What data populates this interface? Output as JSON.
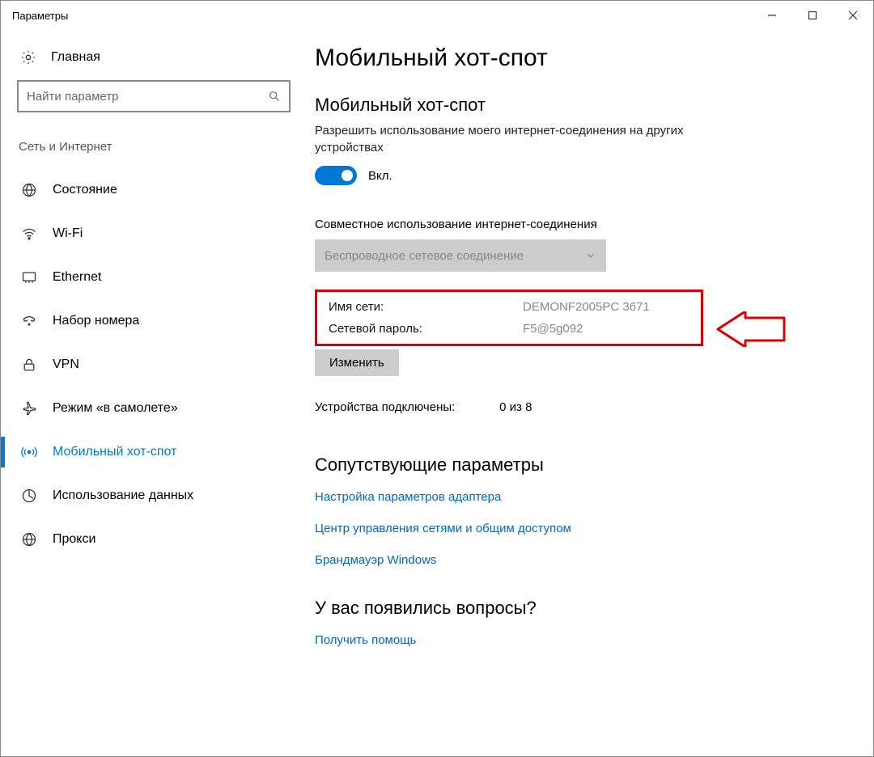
{
  "window": {
    "title": "Параметры"
  },
  "sidebar": {
    "home": "Главная",
    "search_placeholder": "Найти параметр",
    "group": "Сеть и Интернет",
    "items": [
      {
        "icon": "status-icon",
        "label": "Состояние"
      },
      {
        "icon": "wifi-icon",
        "label": "Wi-Fi"
      },
      {
        "icon": "ethernet-icon",
        "label": "Ethernet"
      },
      {
        "icon": "dialup-icon",
        "label": "Набор номера"
      },
      {
        "icon": "vpn-icon",
        "label": "VPN"
      },
      {
        "icon": "airplane-icon",
        "label": "Режим «в самолете»"
      },
      {
        "icon": "hotspot-icon",
        "label": "Мобильный хот-спот",
        "active": true
      },
      {
        "icon": "data-usage-icon",
        "label": "Использование данных"
      },
      {
        "icon": "proxy-icon",
        "label": "Прокси"
      }
    ]
  },
  "main": {
    "title": "Мобильный хот-спот",
    "section_title": "Мобильный хот-спот",
    "description": "Разрешить использование моего интернет-соединения на других устройствах",
    "toggle_label": "Вкл.",
    "share_label": "Совместное использование интернет-соединения",
    "dropdown_value": "Беспроводное сетевое соединение",
    "net_name_label": "Имя сети:",
    "net_name_value": "DEMONF2005PC 3671",
    "net_pass_label": "Сетевой пароль:",
    "net_pass_value": "F5@5g092",
    "change_btn": "Изменить",
    "devices_label": "Устройства подключены:",
    "devices_value": "0 из 8",
    "related_title": "Сопутствующие параметры",
    "related_links": [
      "Настройка параметров адаптера",
      "Центр управления сетями и общим доступом",
      "Брандмауэр Windows"
    ],
    "help_title": "У вас появились вопросы?",
    "help_link": "Получить помощь"
  }
}
